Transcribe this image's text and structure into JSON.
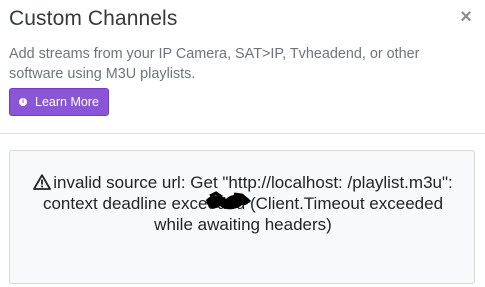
{
  "modal": {
    "title": "Custom Channels",
    "close_label": "×",
    "description": "Add streams from your IP Camera, SAT>IP, Tvheadend, or other software using M3U playlists.",
    "learn_more_label": "Learn More"
  },
  "alert": {
    "message": "invalid source url: Get \"http://localhost:      /playlist.m3u\": context deadline exceeded (Client.Timeout exceeded while awaiting headers)"
  },
  "colors": {
    "accent": "#8a55d6",
    "alert_bg": "#f8f9fa",
    "muted_text": "#6c757d"
  },
  "icons": {
    "close": "close-icon",
    "learn_more": "info-icon",
    "alert": "warning-triangle-icon"
  }
}
